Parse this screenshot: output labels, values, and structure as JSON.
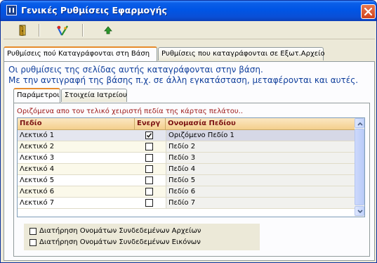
{
  "window": {
    "title": "Γενικές Ρυθμίσεις Εφαρμογής",
    "colors": {
      "titlebar": "#0055e5",
      "close": "#d1431d",
      "header": "#f4cf8c",
      "hint": "#9c1616",
      "info": "#103f9c"
    }
  },
  "toolbar": {
    "icons": [
      "exit-door-icon",
      "save-wizard-icon",
      "up-arrow-icon"
    ]
  },
  "outer_tabs": [
    {
      "label": "Ρυθμίσεις πού Καταγράφονται στη Βάση",
      "active": true
    },
    {
      "label": "Ρυθμίσεις που καταγράφονται σε Εξωτ.Αρχείο",
      "active": false
    }
  ],
  "info": {
    "line1": "Οι ρυθμίσεις της σελίδας αυτής καταγράφονται στην βάση.",
    "line2": "Με την αντιγραφή της βάσης π.χ. σε άλλη εγκατάσταση, μεταφέρονται και αυτές."
  },
  "inner_tabs": [
    {
      "label": "Παράμετροι",
      "active": true
    },
    {
      "label": "Στοιχεία Ιατρείου",
      "active": false
    }
  ],
  "hint": "Οριζόμενα απο τον τελικό χειριστή πεδία της κάρτας πελάτου..",
  "grid": {
    "columns": [
      "Πεδίο",
      "Ενεργ",
      "Ονομασία Πεδίου"
    ],
    "rows": [
      {
        "field": "Λεκτικό 1",
        "active": true,
        "name": "Οριζόμενο Πεδίο 1"
      },
      {
        "field": "Λεκτικό 2",
        "active": false,
        "name": "Πεδίο 2"
      },
      {
        "field": "Λεκτικό 3",
        "active": false,
        "name": "Πεδίο 3"
      },
      {
        "field": "Λεκτικό 4",
        "active": false,
        "name": "Πεδίο 4"
      },
      {
        "field": "Λεκτικό 5",
        "active": false,
        "name": "Πεδίο 5"
      },
      {
        "field": "Λεκτικό 6",
        "active": false,
        "name": "Πεδίο 6"
      },
      {
        "field": "Λεκτικό 7",
        "active": false,
        "name": "Πεδίο 7"
      }
    ]
  },
  "options": [
    {
      "label": "Διατήρηση Ονομάτων Συνδεδεμένων Αρχείων",
      "checked": false
    },
    {
      "label": "Διατήρηση Ονομάτων Συνδεδεμένων Εικόνων",
      "checked": false
    }
  ]
}
